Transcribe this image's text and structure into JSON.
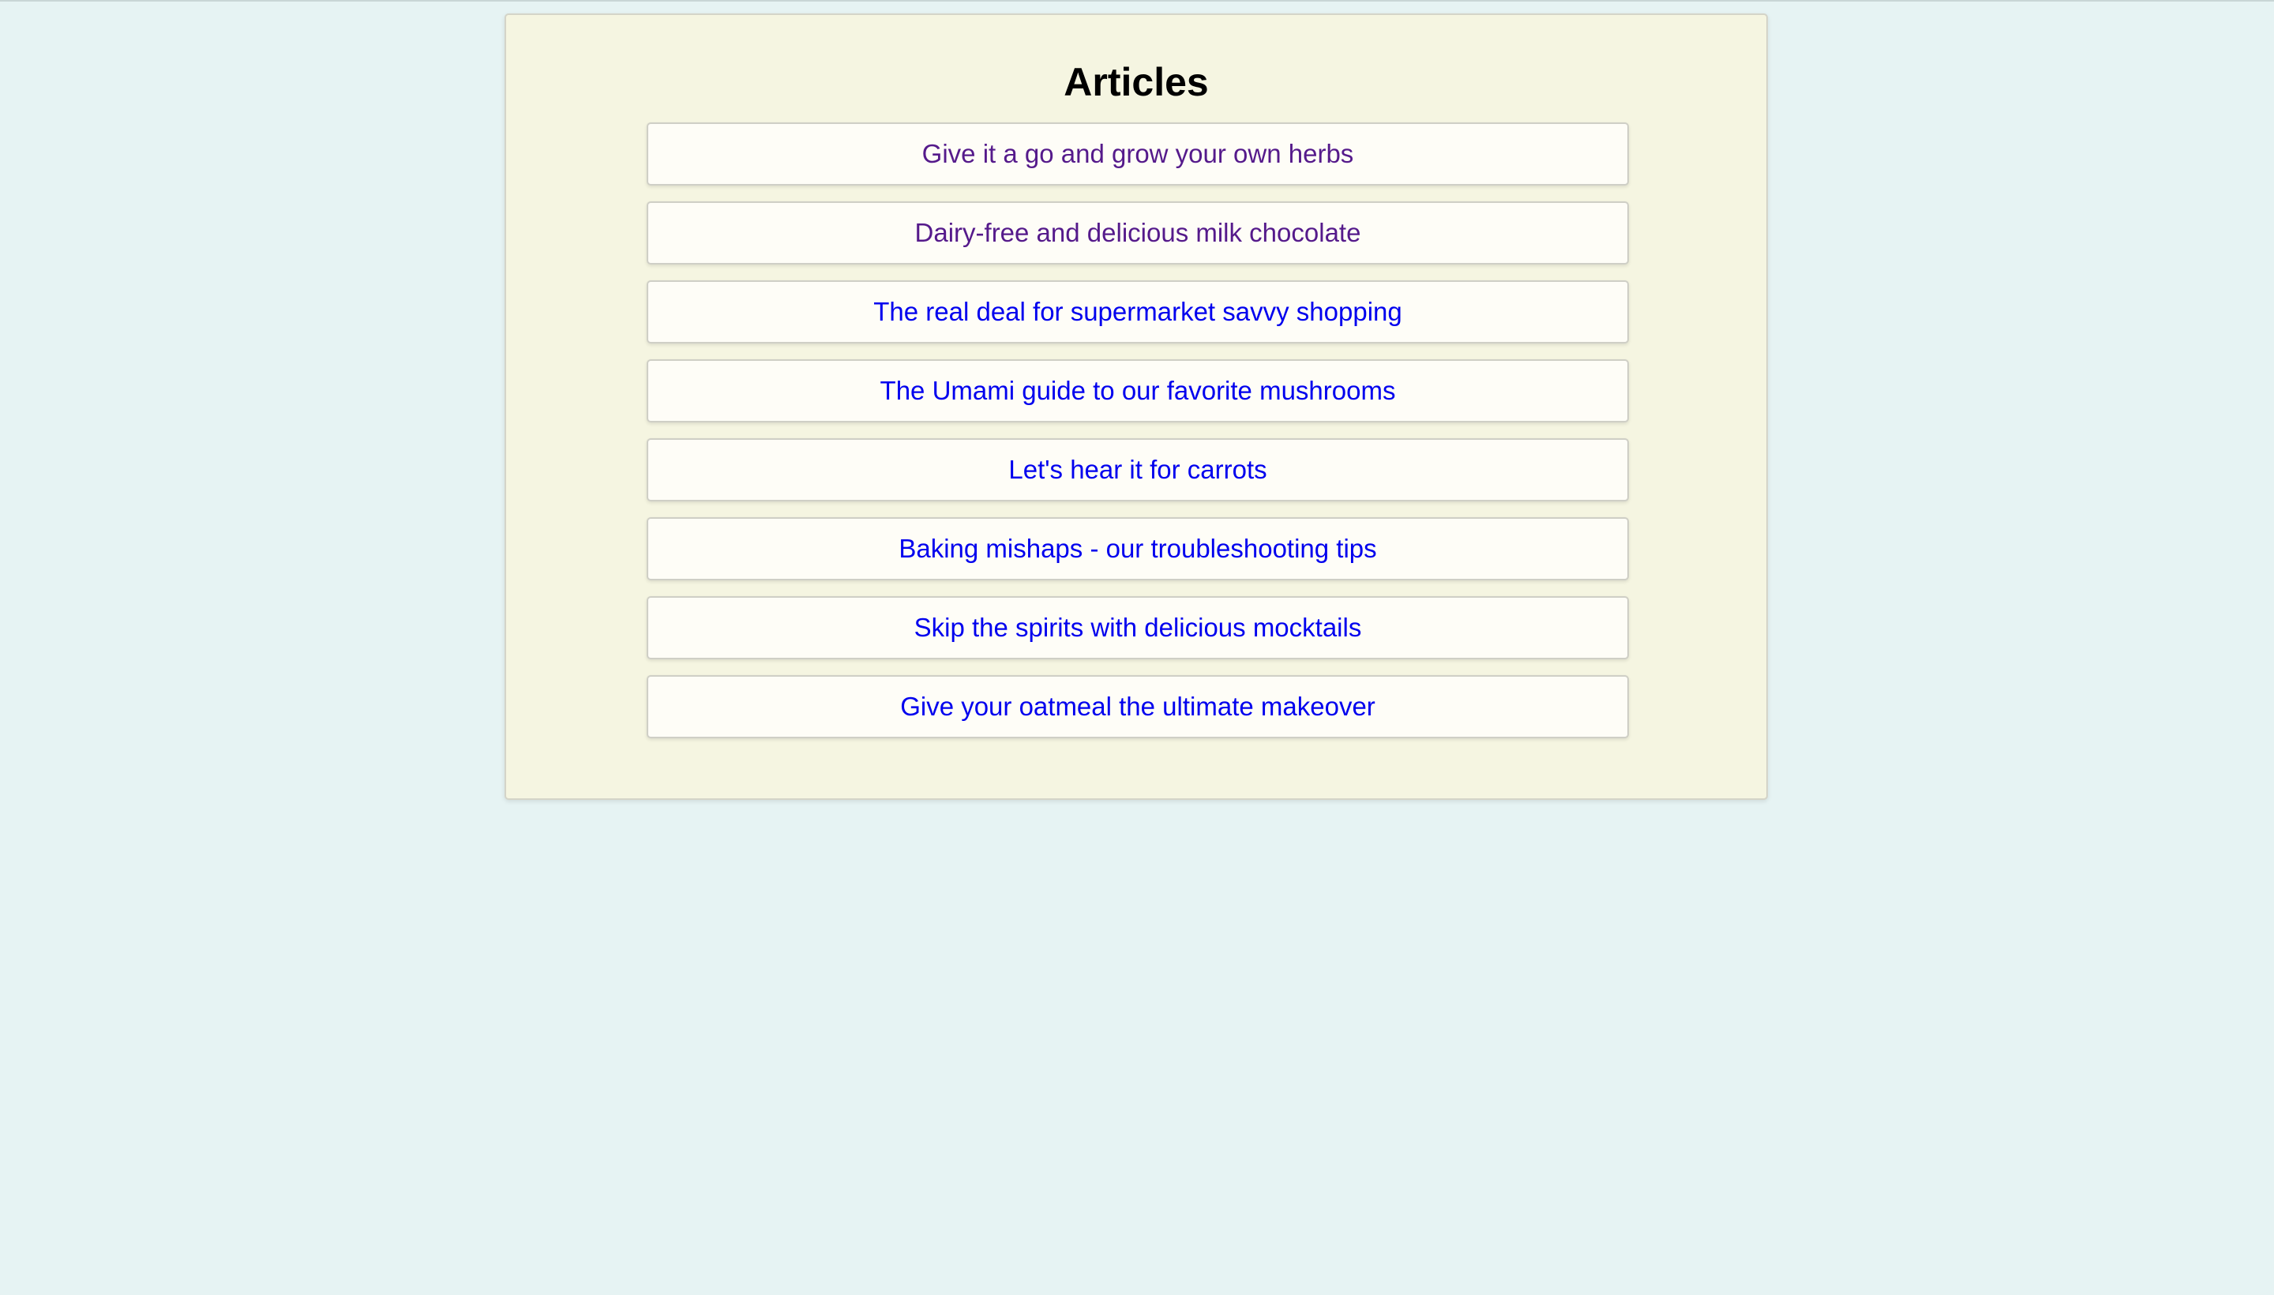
{
  "page": {
    "title": "Articles"
  },
  "colors": {
    "background": "#e6f3f3",
    "panel": "#f5f5e1",
    "link_unvisited": "#0000ee",
    "link_visited": "#551a8b"
  },
  "articles": [
    {
      "title": "Give it a go and grow your own herbs",
      "visited": true
    },
    {
      "title": "Dairy-free and delicious milk chocolate",
      "visited": true
    },
    {
      "title": "The real deal for supermarket savvy shopping",
      "visited": false
    },
    {
      "title": "The Umami guide to our favorite mushrooms",
      "visited": false
    },
    {
      "title": "Let's hear it for carrots",
      "visited": false
    },
    {
      "title": "Baking mishaps - our troubleshooting tips",
      "visited": false
    },
    {
      "title": "Skip the spirits with delicious mocktails",
      "visited": false
    },
    {
      "title": "Give your oatmeal the ultimate makeover",
      "visited": false
    }
  ]
}
